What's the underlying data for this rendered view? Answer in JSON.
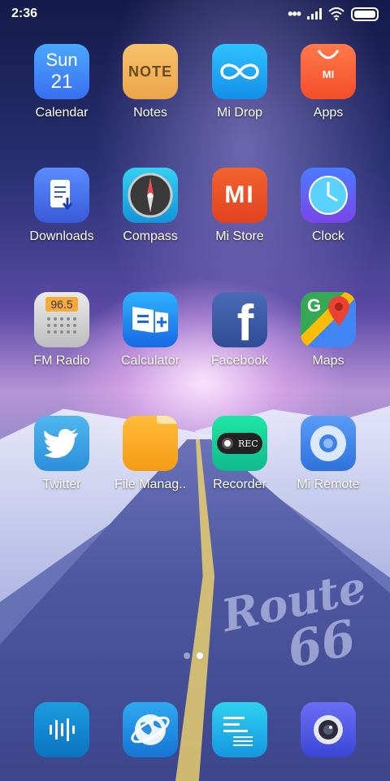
{
  "status_bar": {
    "time": "2:36"
  },
  "apps": [
    {
      "label": "Calendar",
      "tile_top": "Sun",
      "tile_bottom": "21"
    },
    {
      "label": "Notes",
      "tile_text": "NOTE"
    },
    {
      "label": "Mi Drop"
    },
    {
      "label": "Apps",
      "tile_text": "MI"
    },
    {
      "label": "Downloads"
    },
    {
      "label": "Compass"
    },
    {
      "label": "Mi Store",
      "tile_text": "MI"
    },
    {
      "label": "Clock"
    },
    {
      "label": "FM Radio",
      "tile_text": "96.5"
    },
    {
      "label": "Calculator"
    },
    {
      "label": "Facebook",
      "tile_text": "f"
    },
    {
      "label": "Maps",
      "tile_text": "G"
    },
    {
      "label": "Twitter"
    },
    {
      "label": "File Manag.."
    },
    {
      "label": "Recorder",
      "tile_text": "REC"
    },
    {
      "label": "Mi Remote"
    }
  ],
  "wallpaper_text": {
    "line1": "Route",
    "line2": "66"
  },
  "page_indicator": {
    "pages": 2,
    "current": 2
  },
  "colors": {
    "calendar": "#3f86f5",
    "notes": "#f2b45c",
    "midrop": "#1aa6ef",
    "apps": "#f86038",
    "downloads": "#3d76e6",
    "compass": "#1fb4e6",
    "mistore": "#ef5326",
    "clock": "#3f67f0",
    "fmradio": "#d8d8d8",
    "calculator": "#1d8ef0",
    "facebook": "#3b5998",
    "maps": "#ffffff",
    "twitter": "#42a9e8",
    "filemanager": "#f7a823",
    "recorder": "#14d196",
    "miremote": "#3b80e8"
  }
}
